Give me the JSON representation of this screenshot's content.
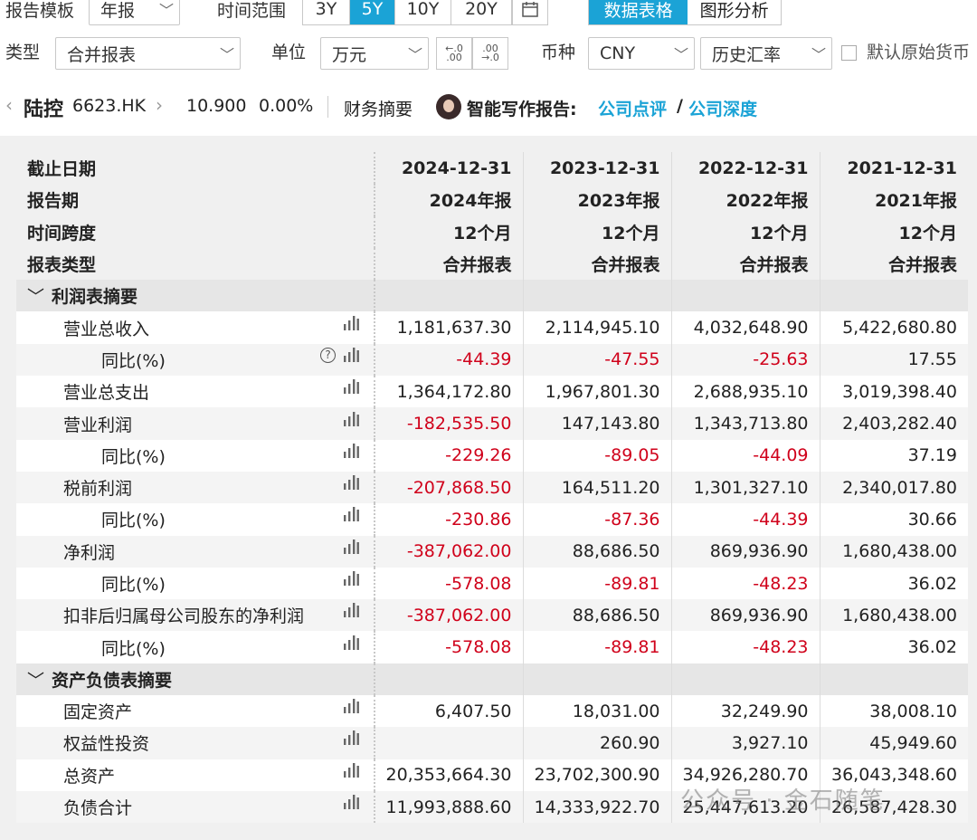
{
  "toolbar": {
    "template_label": "报告模板",
    "template_value": "年报",
    "range_label": "时间范围",
    "range_options": [
      "3Y",
      "5Y",
      "10Y",
      "20Y"
    ],
    "range_selected": "5Y",
    "view_tabs": [
      "数据表格",
      "图形分析"
    ],
    "view_selected": "数据表格",
    "type_label": "类型",
    "type_value": "合并报表",
    "unit_label": "单位",
    "unit_value": "万元",
    "currency_label": "币种",
    "currency_value": "CNY",
    "rate_value": "历史汇率",
    "original_currency_label": "默认原始货币"
  },
  "stock": {
    "name": "陆控",
    "code": "6623.HK",
    "price": "10.900",
    "change": "0.00%",
    "section": "财务摘要",
    "ai_label": "智能写作报告:",
    "link1": "公司点评",
    "sep": "/",
    "link2": "公司深度"
  },
  "table": {
    "header_rows": [
      {
        "label": "截止日期",
        "values": [
          "2024-12-31",
          "2023-12-31",
          "2022-12-31",
          "2021-12-31"
        ]
      },
      {
        "label": "报告期",
        "values": [
          "2024年报",
          "2023年报",
          "2022年报",
          "2021年报"
        ]
      },
      {
        "label": "时间跨度",
        "values": [
          "12个月",
          "12个月",
          "12个月",
          "12个月"
        ]
      },
      {
        "label": "报表类型",
        "values": [
          "合并报表",
          "合并报表",
          "合并报表",
          "合并报表"
        ]
      }
    ],
    "sections": [
      {
        "title": "利润表摘要",
        "rows": [
          {
            "label": "营业总收入",
            "indent": 1,
            "values": [
              "1,181,637.30",
              "2,114,945.10",
              "4,032,648.90",
              "5,422,680.80"
            ]
          },
          {
            "label": "同比(%)",
            "indent": 2,
            "help": true,
            "values": [
              "-44.39",
              "-47.55",
              "-25.63",
              "17.55"
            ]
          },
          {
            "label": "营业总支出",
            "indent": 1,
            "values": [
              "1,364,172.80",
              "1,967,801.30",
              "2,688,935.10",
              "3,019,398.40"
            ]
          },
          {
            "label": "营业利润",
            "indent": 1,
            "values": [
              "-182,535.50",
              "147,143.80",
              "1,343,713.80",
              "2,403,282.40"
            ]
          },
          {
            "label": "同比(%)",
            "indent": 2,
            "values": [
              "-229.26",
              "-89.05",
              "-44.09",
              "37.19"
            ]
          },
          {
            "label": "税前利润",
            "indent": 1,
            "values": [
              "-207,868.50",
              "164,511.20",
              "1,301,327.10",
              "2,340,017.80"
            ]
          },
          {
            "label": "同比(%)",
            "indent": 2,
            "values": [
              "-230.86",
              "-87.36",
              "-44.39",
              "30.66"
            ]
          },
          {
            "label": "净利润",
            "indent": 1,
            "values": [
              "-387,062.00",
              "88,686.50",
              "869,936.90",
              "1,680,438.00"
            ]
          },
          {
            "label": "同比(%)",
            "indent": 2,
            "values": [
              "-578.08",
              "-89.81",
              "-48.23",
              "36.02"
            ]
          },
          {
            "label": "扣非后归属母公司股东的净利润",
            "indent": 1,
            "values": [
              "-387,062.00",
              "88,686.50",
              "869,936.90",
              "1,680,438.00"
            ]
          },
          {
            "label": "同比(%)",
            "indent": 2,
            "values": [
              "-578.08",
              "-89.81",
              "-48.23",
              "36.02"
            ]
          }
        ]
      },
      {
        "title": "资产负债表摘要",
        "rows": [
          {
            "label": "固定资产",
            "indent": 1,
            "values": [
              "6,407.50",
              "18,031.00",
              "32,249.90",
              "38,008.10"
            ]
          },
          {
            "label": "权益性投资",
            "indent": 1,
            "values": [
              "",
              "260.90",
              "3,927.10",
              "45,949.60"
            ]
          },
          {
            "label": "总资产",
            "indent": 1,
            "values": [
              "20,353,664.30",
              "23,702,300.90",
              "34,926,280.70",
              "36,043,348.60"
            ]
          },
          {
            "label": "负债合计",
            "indent": 1,
            "values": [
              "11,993,888.60",
              "14,333,922.70",
              "25,447,613.20",
              "26,587,428.30"
            ]
          }
        ]
      }
    ]
  },
  "watermark": "公众号 · 金石随笔",
  "colors": {
    "accent": "#1ba3d6",
    "negative": "#d0021b",
    "link": "#1ba3d6"
  }
}
